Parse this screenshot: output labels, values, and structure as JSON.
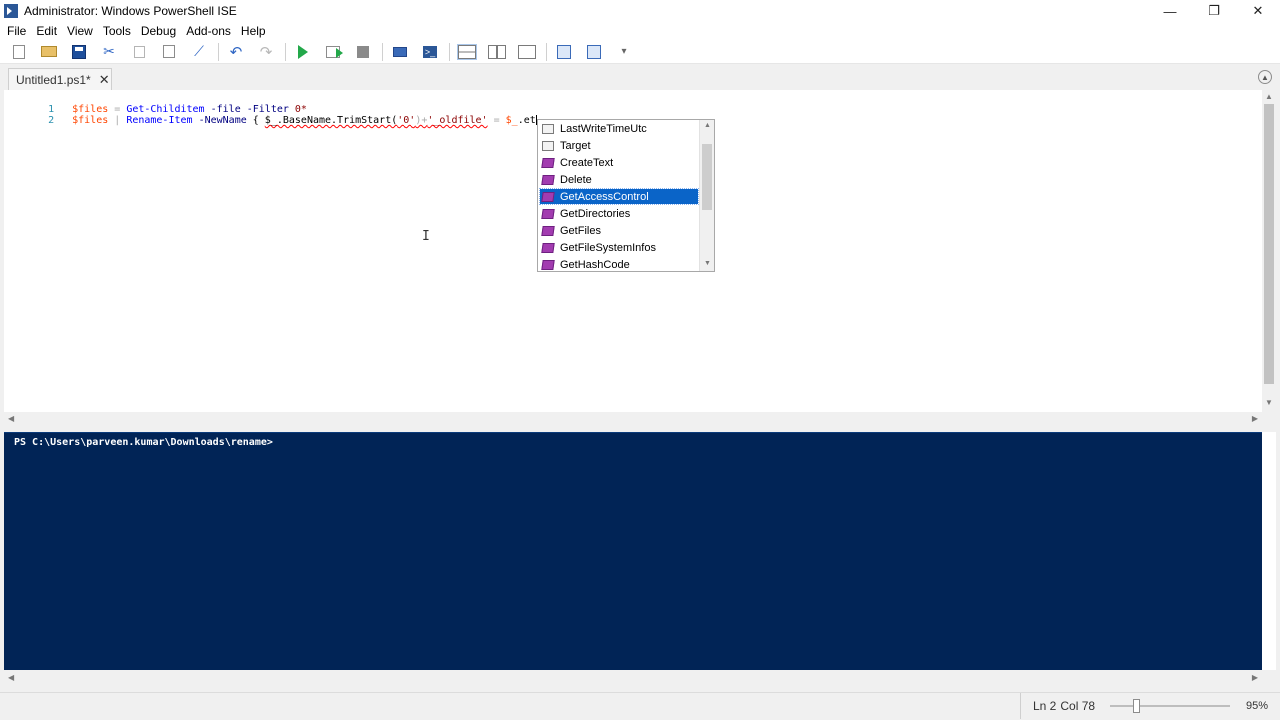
{
  "window": {
    "title": "Administrator: Windows PowerShell ISE",
    "minimize": "—",
    "restore": "❐",
    "close": "✕"
  },
  "menu": {
    "items": [
      {
        "label": "File"
      },
      {
        "label": "Edit"
      },
      {
        "label": "View"
      },
      {
        "label": "Tools"
      },
      {
        "label": "Debug"
      },
      {
        "label": "Add-ons"
      },
      {
        "label": "Help"
      }
    ]
  },
  "tab": {
    "label": "Untitled1.ps1*",
    "close": "✕"
  },
  "editor": {
    "lines": [
      {
        "number": "1"
      },
      {
        "number": "2"
      }
    ],
    "line1": {
      "var": "$files",
      "eq": " = ",
      "cmd": "Get-Childitem",
      "p1": " -file",
      "p2": " -Filter",
      "arg": " 0*"
    },
    "line2": {
      "var": "$files",
      "pipe": " | ",
      "cmd": "Rename-Item",
      "p1": " -NewName",
      "brace": " { ",
      "expr": "$_.BaseName.TrimStart(",
      "str1": "'0'",
      "plus": ")+",
      "str2": "'_oldfile'",
      "eq": " = ",
      "var2": "$_",
      "tail": ".et"
    }
  },
  "autocomplete": {
    "items": [
      {
        "label": "LastWriteTimeUtc",
        "kind": "property"
      },
      {
        "label": "Target",
        "kind": "property"
      },
      {
        "label": "CreateText",
        "kind": "method"
      },
      {
        "label": "Delete",
        "kind": "method"
      },
      {
        "label": "GetAccessControl",
        "kind": "method",
        "selected": true
      },
      {
        "label": "GetDirectories",
        "kind": "method"
      },
      {
        "label": "GetFiles",
        "kind": "method"
      },
      {
        "label": "GetFileSystemInfos",
        "kind": "method"
      },
      {
        "label": "GetHashCode",
        "kind": "method"
      }
    ]
  },
  "console": {
    "prompt": "PS C:\\Users\\parveen.kumar\\Downloads\\rename>"
  },
  "status": {
    "line": "Ln 2",
    "col": "Col 78",
    "zoom": "95%",
    "zoom_value": 95
  },
  "colors": {
    "console_bg": "#012456",
    "selection": "#0a64c8"
  }
}
